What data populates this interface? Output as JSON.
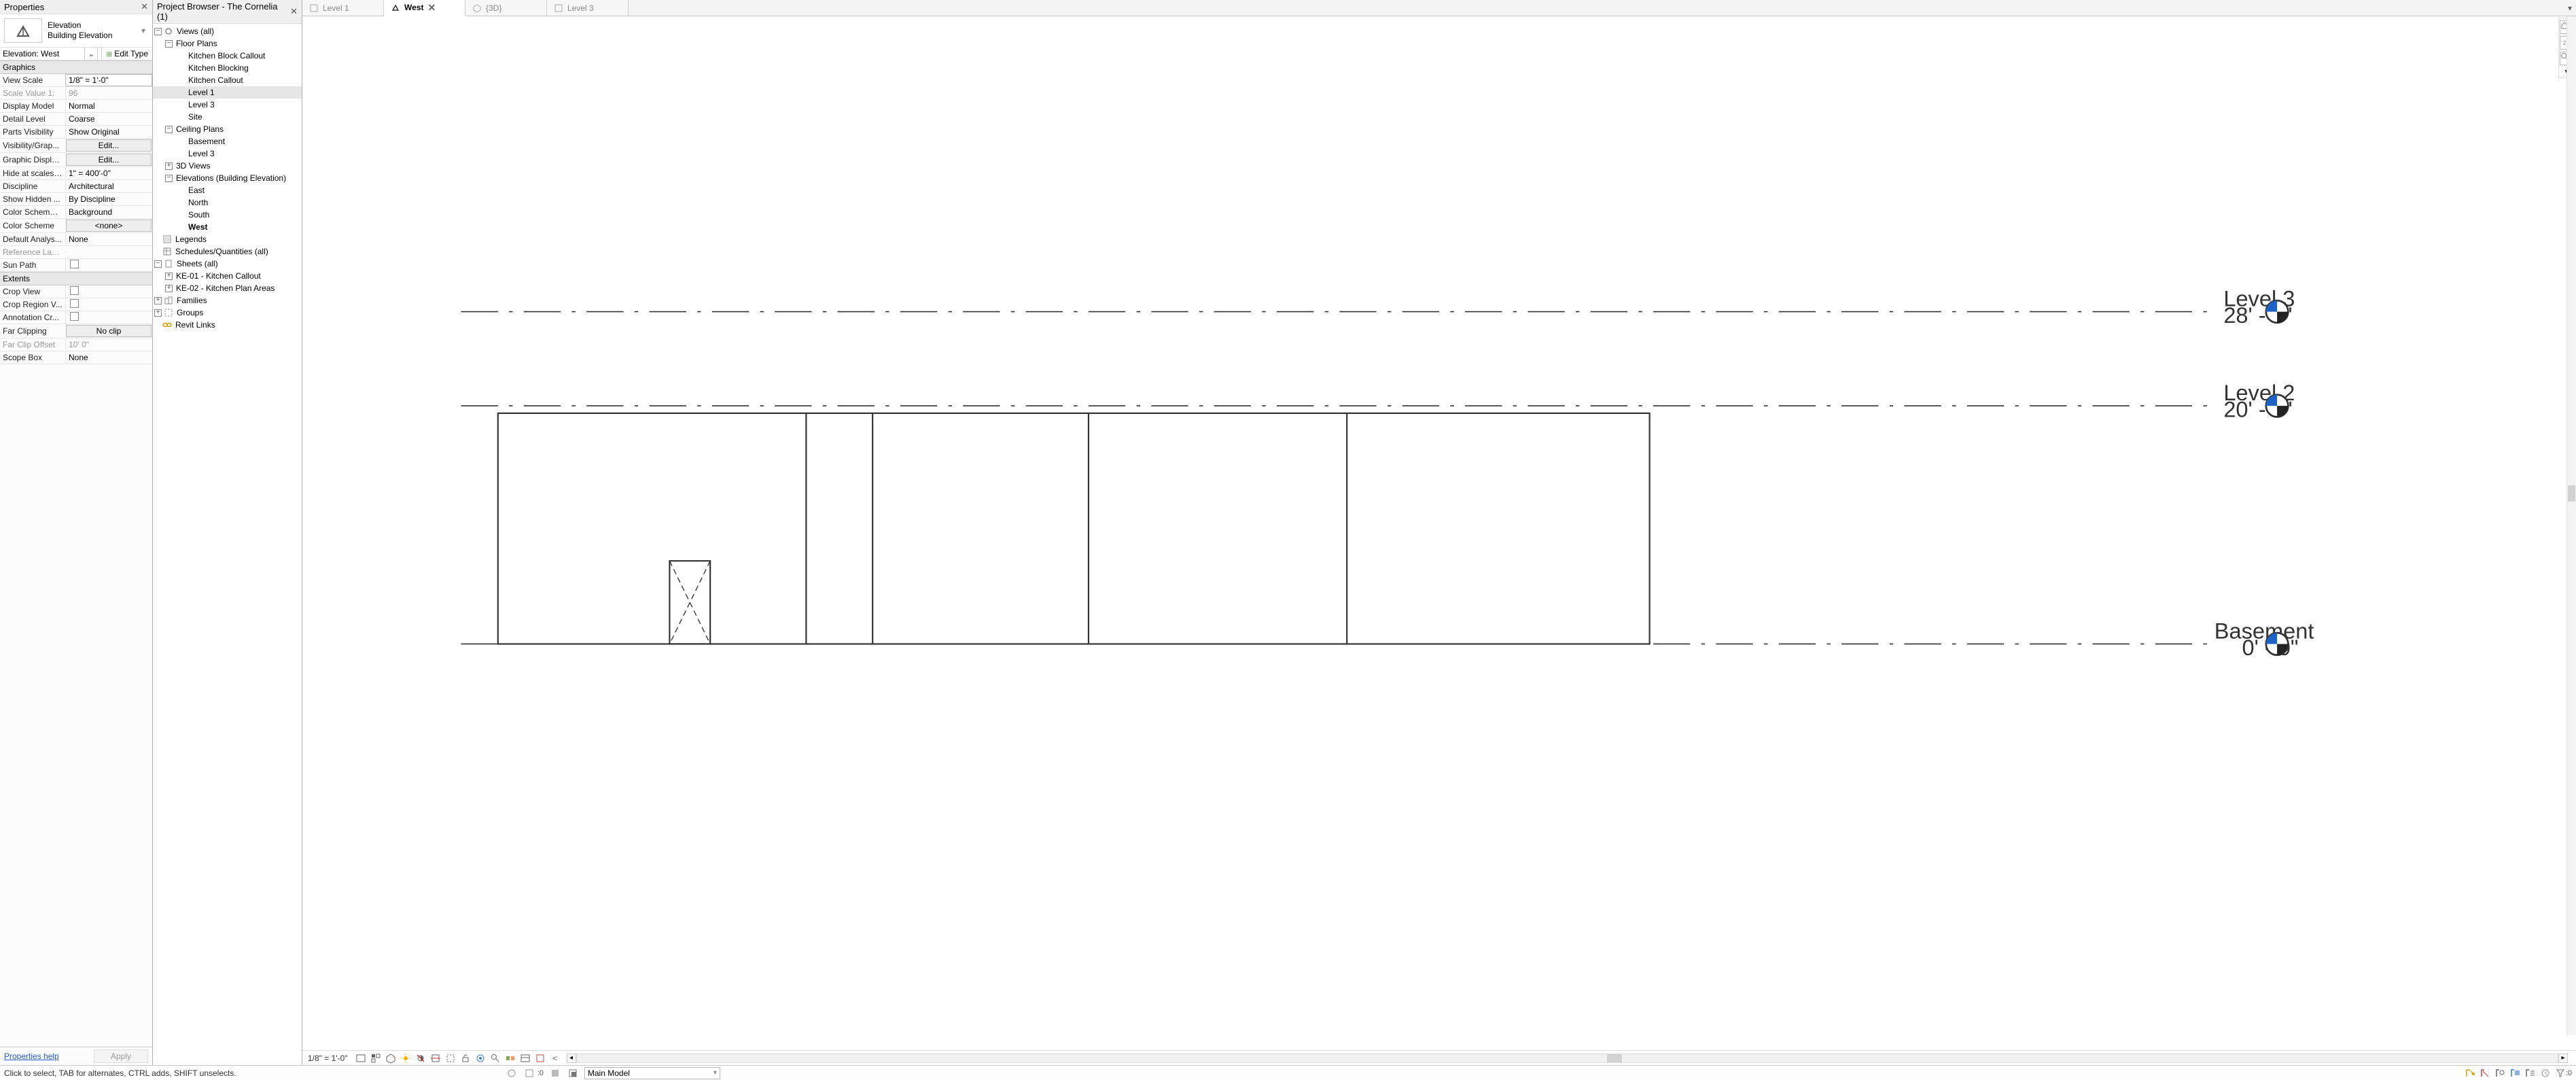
{
  "panels": {
    "properties_title": "Properties",
    "browser_title": "Project Browser - The Cornelia (1)"
  },
  "type_selector": {
    "category": "Elevation",
    "type": "Building Elevation"
  },
  "instance": {
    "name": "Elevation: West",
    "edit_type": "Edit Type"
  },
  "prop_groups": {
    "graphics": "Graphics",
    "extents": "Extents"
  },
  "props": {
    "view_scale_l": "View Scale",
    "view_scale_v": "1/8\"  =  1'-0\"",
    "scale_value_l": "Scale Value    1:",
    "scale_value_v": "96",
    "display_model_l": "Display Model",
    "display_model_v": "Normal",
    "detail_level_l": "Detail Level",
    "detail_level_v": "Coarse",
    "parts_vis_l": "Parts Visibility",
    "parts_vis_v": "Show Original",
    "vg_l": "Visibility/Grap...",
    "vg_v": "Edit...",
    "gdo_l": "Graphic Displa...",
    "gdo_v": "Edit...",
    "hide_scales_l": "Hide at scales ...",
    "hide_scales_v": "1\"  =  400'-0\"",
    "discipline_l": "Discipline",
    "discipline_v": "Architectural",
    "show_hidden_l": "Show Hidden ...",
    "show_hidden_v": "By Discipline",
    "cs_loc_l": "Color Scheme ...",
    "cs_loc_v": "Background",
    "cs_l": "Color Scheme",
    "cs_v": "<none>",
    "def_anal_l": "Default Analys...",
    "def_anal_v": "None",
    "ref_lbl_l": "Reference Label",
    "ref_lbl_v": "",
    "sun_path_l": "Sun Path",
    "crop_view_l": "Crop View",
    "crop_region_l": "Crop Region V...",
    "anno_crop_l": "Annotation Cr...",
    "far_clip_l": "Far Clipping",
    "far_clip_v": "No clip",
    "far_clip_off_l": "Far Clip Offset",
    "far_clip_off_v": "10'  0\"",
    "scope_box_l": "Scope Box",
    "scope_box_v": "None"
  },
  "prop_footer": {
    "help": "Properties help",
    "apply": "Apply"
  },
  "tree": {
    "views_all": "Views (all)",
    "floor_plans": "Floor Plans",
    "kitchen_block_callout": "Kitchen Block Callout",
    "kitchen_blocking": "Kitchen Blocking",
    "kitchen_callout": "Kitchen Callout",
    "level1": "Level 1",
    "level3": "Level 3",
    "site": "Site",
    "ceiling_plans": "Ceiling Plans",
    "basement": "Basement",
    "cp_level3": "Level 3",
    "views3d": "3D Views",
    "elevations": "Elevations (Building Elevation)",
    "east": "East",
    "north": "North",
    "south": "South",
    "west": "West",
    "legends": "Legends",
    "schedules": "Schedules/Quantities (all)",
    "sheets": "Sheets (all)",
    "ke01": "KE-01 - Kitchen Callout",
    "ke02": "KE-02 - Kitchen Plan Areas",
    "families": "Families",
    "groups": "Groups",
    "revit_links": "Revit Links"
  },
  "tabs": {
    "level1": "Level 1",
    "west": "West",
    "three_d": "{3D}",
    "level3": "Level 3"
  },
  "canvas_levels": {
    "l3_name": "Level 3",
    "l3_elev": "28' - 6\"",
    "l2_name": "Level 2",
    "l2_elev": "20' - 0\"",
    "b_name": "Basement",
    "b_elev": "0' - 0\""
  },
  "view_controls": {
    "scale": "1/8\" = 1'-0\""
  },
  "status": {
    "hint": "Click to select, TAB for alternates, CTRL adds, SHIFT unselects.",
    "sel_count": ":0",
    "main_model": "Main Model",
    "filter_count": ":0"
  }
}
